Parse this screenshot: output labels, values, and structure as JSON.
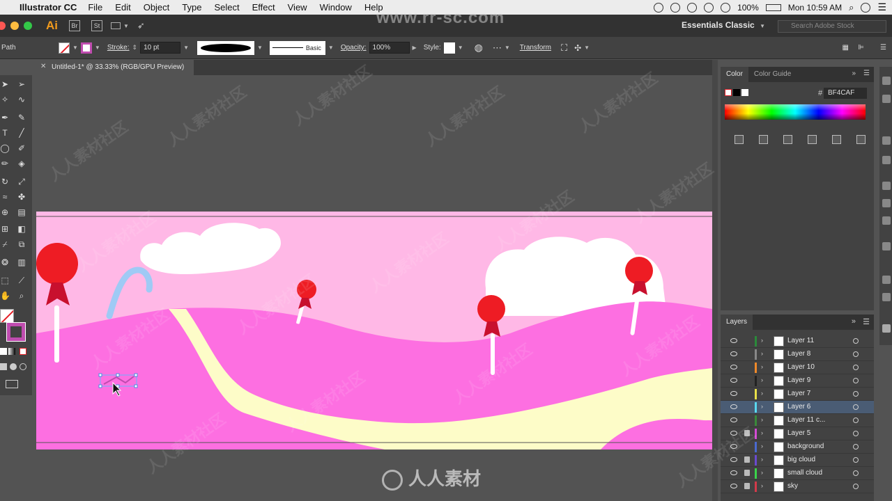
{
  "menubar": {
    "app_name": "Illustrator CC",
    "items": [
      "File",
      "Edit",
      "Object",
      "Type",
      "Select",
      "Effect",
      "View",
      "Window",
      "Help"
    ],
    "battery": "100%",
    "clock": "Mon 10:59 AM"
  },
  "appbar": {
    "logo": "Ai",
    "bridge": "Br",
    "stock": "St",
    "workspace": "Essentials Classic",
    "search_placeholder": "Search Adobe Stock"
  },
  "controlbar": {
    "selection": "Path",
    "stroke_label": "Stroke:",
    "stroke_value": "10 pt",
    "brush_label": "Basic",
    "opacity_label": "Opacity:",
    "opacity_value": "100%",
    "style_label": "Style:",
    "transform_label": "Transform"
  },
  "document": {
    "tab_title": "Untitled-1* @ 33.33% (RGB/GPU Preview)"
  },
  "color_panel": {
    "tabs": [
      "Color",
      "Color Guide"
    ],
    "hex_prefix": "#",
    "hex": "BF4CAF"
  },
  "layers_panel": {
    "title": "Layers",
    "rows": [
      {
        "name": "Layer 11",
        "color": "#2a8b3a",
        "locked": false,
        "selected": false
      },
      {
        "name": "Layer 8",
        "color": "#888888",
        "locked": false,
        "selected": false
      },
      {
        "name": "Layer 10",
        "color": "#f08a2a",
        "locked": false,
        "selected": false
      },
      {
        "name": "Layer 9",
        "color": "#222222",
        "locked": false,
        "selected": false
      },
      {
        "name": "Layer 7",
        "color": "#e8e048",
        "locked": false,
        "selected": false
      },
      {
        "name": "Layer 6",
        "color": "#5ad8f0",
        "locked": false,
        "selected": true
      },
      {
        "name": "Layer 11 c...",
        "color": "#3a8a3a",
        "locked": false,
        "selected": false
      },
      {
        "name": "Layer 5",
        "color": "#d44ad4",
        "locked": true,
        "selected": false
      },
      {
        "name": "background",
        "color": "#4a6ad0",
        "locked": false,
        "selected": false
      },
      {
        "name": "big cloud",
        "color": "#6a4ad0",
        "locked": true,
        "selected": false
      },
      {
        "name": "small cloud",
        "color": "#3ad44a",
        "locked": true,
        "selected": false
      },
      {
        "name": "sky",
        "color": "#d43a4a",
        "locked": true,
        "selected": false
      }
    ]
  },
  "watermark": {
    "url": "www.rr-sc.com",
    "brand": "人人素材",
    "tile": "人人素材社区"
  },
  "colors": {
    "sky": "#ffb8e6",
    "hill_back": "#fd6fe1",
    "path": "#fdfcc8",
    "lollipop": "#ee1c24",
    "cloud": "#ffffff",
    "cane": "#9fcaf5",
    "selected_color": "#bf4caf"
  }
}
